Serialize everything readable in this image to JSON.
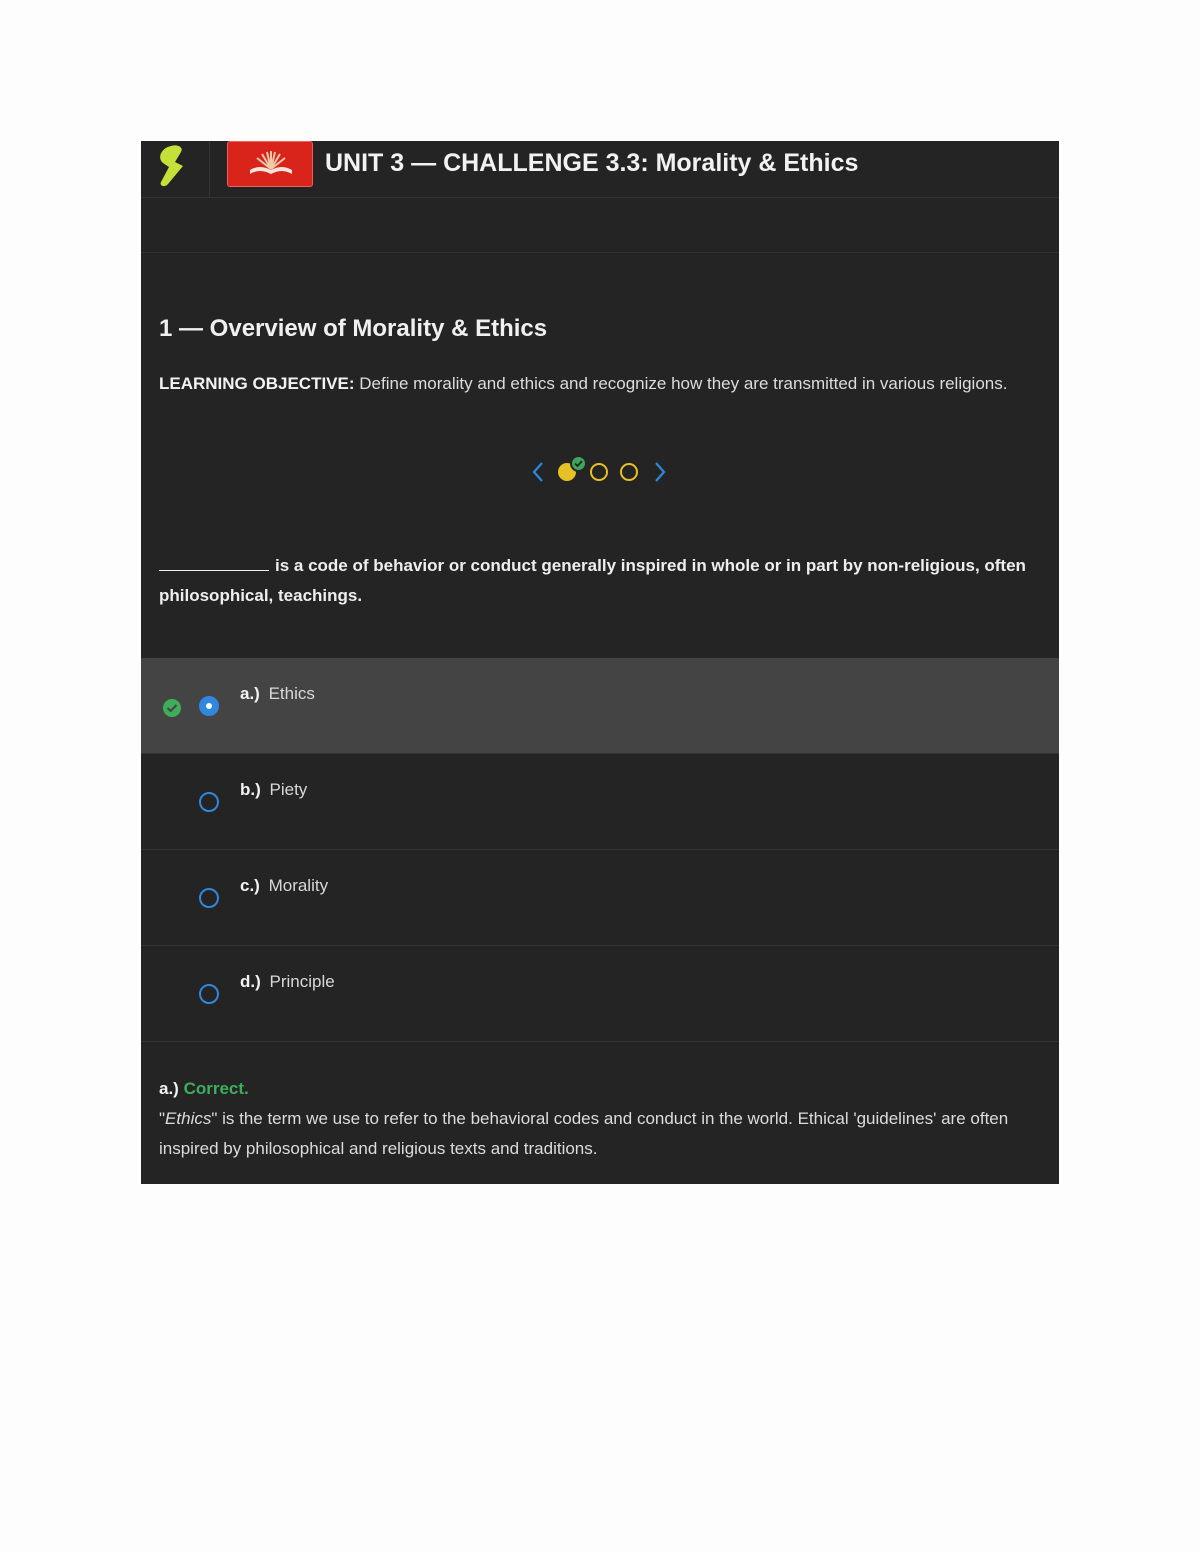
{
  "header": {
    "unit_title": "UNIT 3 — CHALLENGE 3.3: Morality & Ethics"
  },
  "section": {
    "title": "1 — Overview of Morality & Ethics",
    "objective_label": "LEARNING OBJECTIVE:",
    "objective_text": " Define morality and ethics and recognize how they are transmitted in various religions."
  },
  "pager": {
    "current": 1,
    "total": 3,
    "completed": [
      1
    ]
  },
  "question": {
    "text": "is a code of behavior or conduct generally inspired in whole or in part by non-religious, often philosophical, teachings."
  },
  "options": [
    {
      "letter": "a.)",
      "text": "Ethics",
      "selected": true,
      "correct": true
    },
    {
      "letter": "b.)",
      "text": "Piety",
      "selected": false,
      "correct": false
    },
    {
      "letter": "c.)",
      "text": "Morality",
      "selected": false,
      "correct": false
    },
    {
      "letter": "d.)",
      "text": "Principle",
      "selected": false,
      "correct": false
    }
  ],
  "feedback": {
    "letter": "a.)",
    "status": "Correct.",
    "quote_open": "\"",
    "term": "Ethics",
    "body": "\" is the term we use to refer to the behavioral codes and conduct in the world. Ethical 'guidelines' are often inspired by philosophical and religious texts and traditions."
  },
  "colors": {
    "panel_bg": "#242424",
    "selected_bg": "#444444",
    "accent_blue": "#2f87e0",
    "correct_green": "#3fae5c",
    "pager_yellow": "#e6c024",
    "brand_lime": "#c6e03a",
    "badge_red": "#d9241c"
  },
  "icons": {
    "logo": "lightning-logo-icon",
    "course": "open-book-icon",
    "prev": "chevron-left-icon",
    "next": "chevron-right-icon",
    "check": "check-circle-icon"
  }
}
